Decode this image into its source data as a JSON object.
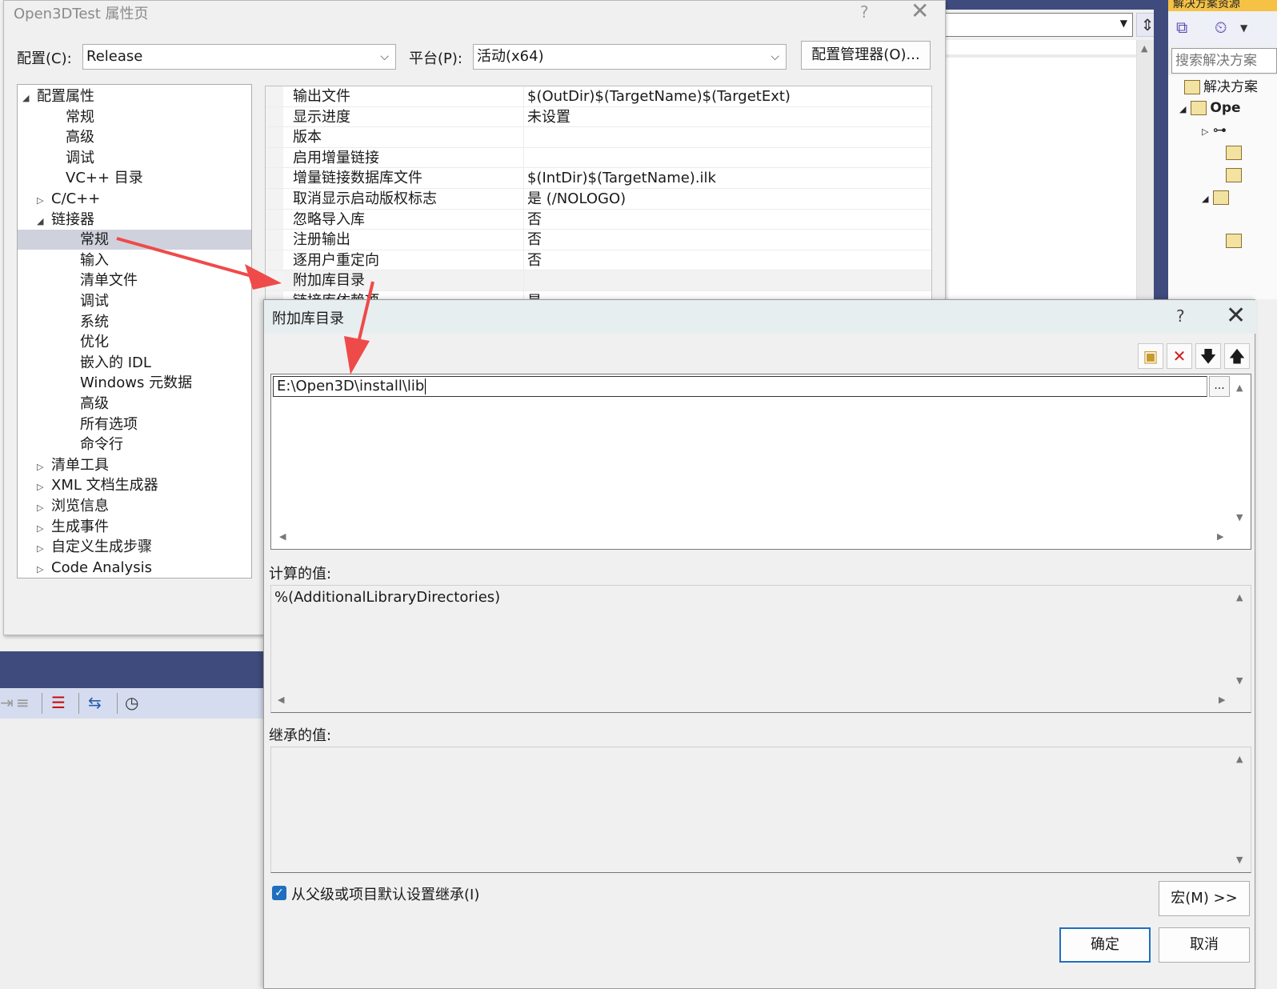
{
  "ide": {
    "solution_explorer_header": "解决方案资源",
    "search_placeholder": "搜索解决方案",
    "tree": [
      "解决方案",
      "Ope"
    ]
  },
  "property_dialog": {
    "title": "Open3DTest 属性页",
    "help": "?",
    "close": "✕",
    "config_label": "配置(C):",
    "config_value": "Release",
    "platform_label": "平台(P):",
    "platform_value": "活动(x64)",
    "config_manager_button": "配置管理器(O)...",
    "tree": [
      {
        "label": "配置属性",
        "indent": 0,
        "arrow": "◢"
      },
      {
        "label": "常规",
        "indent": 2,
        "arrow": ""
      },
      {
        "label": "高级",
        "indent": 2,
        "arrow": ""
      },
      {
        "label": "调试",
        "indent": 2,
        "arrow": ""
      },
      {
        "label": "VC++ 目录",
        "indent": 2,
        "arrow": ""
      },
      {
        "label": "C/C++",
        "indent": 1,
        "arrow": "▷"
      },
      {
        "label": "链接器",
        "indent": 1,
        "arrow": "◢"
      },
      {
        "label": "常规",
        "indent": 3,
        "arrow": "",
        "selected": true
      },
      {
        "label": "输入",
        "indent": 3,
        "arrow": ""
      },
      {
        "label": "清单文件",
        "indent": 3,
        "arrow": ""
      },
      {
        "label": "调试",
        "indent": 3,
        "arrow": ""
      },
      {
        "label": "系统",
        "indent": 3,
        "arrow": ""
      },
      {
        "label": "优化",
        "indent": 3,
        "arrow": ""
      },
      {
        "label": "嵌入的 IDL",
        "indent": 3,
        "arrow": ""
      },
      {
        "label": "Windows 元数据",
        "indent": 3,
        "arrow": ""
      },
      {
        "label": "高级",
        "indent": 3,
        "arrow": ""
      },
      {
        "label": "所有选项",
        "indent": 3,
        "arrow": ""
      },
      {
        "label": "命令行",
        "indent": 3,
        "arrow": ""
      },
      {
        "label": "清单工具",
        "indent": 1,
        "arrow": "▷"
      },
      {
        "label": "XML 文档生成器",
        "indent": 1,
        "arrow": "▷"
      },
      {
        "label": "浏览信息",
        "indent": 1,
        "arrow": "▷"
      },
      {
        "label": "生成事件",
        "indent": 1,
        "arrow": "▷"
      },
      {
        "label": "自定义生成步骤",
        "indent": 1,
        "arrow": "▷"
      },
      {
        "label": "Code Analysis",
        "indent": 1,
        "arrow": "▷"
      }
    ],
    "properties": [
      {
        "name": "输出文件",
        "value": "$(OutDir)$(TargetName)$(TargetExt)"
      },
      {
        "name": "显示进度",
        "value": "未设置"
      },
      {
        "name": "版本",
        "value": ""
      },
      {
        "name": "启用增量链接",
        "value": ""
      },
      {
        "name": "增量链接数据库文件",
        "value": "$(IntDir)$(TargetName).ilk"
      },
      {
        "name": "取消显示启动版权标志",
        "value": "是 (/NOLOGO)"
      },
      {
        "name": "忽略导入库",
        "value": "否"
      },
      {
        "name": "注册输出",
        "value": "否"
      },
      {
        "name": "逐用户重定向",
        "value": "否"
      },
      {
        "name": "附加库目录",
        "value": "",
        "highlighted": true
      },
      {
        "name": "链接库依赖项",
        "value": "是"
      }
    ]
  },
  "lib_dialog": {
    "title": "附加库目录",
    "help": "?",
    "close": "✕",
    "entry_value": "E:\\Open3D\\install\\lib",
    "browse_label": "...",
    "computed_label": "计算的值:",
    "computed_value": "%(AdditionalLibraryDirectories)",
    "inherited_label": "继承的值:",
    "inherit_checkbox_label": "从父级或项目默认设置继承(I)",
    "inherit_checked": true,
    "macro_button": "宏(M) >>",
    "ok_button": "确定",
    "cancel_button": "取消"
  },
  "colors": {
    "arrow": "#ef4a4a",
    "accent": "#1f6fbf",
    "ide_band": "#3f4b7d"
  }
}
